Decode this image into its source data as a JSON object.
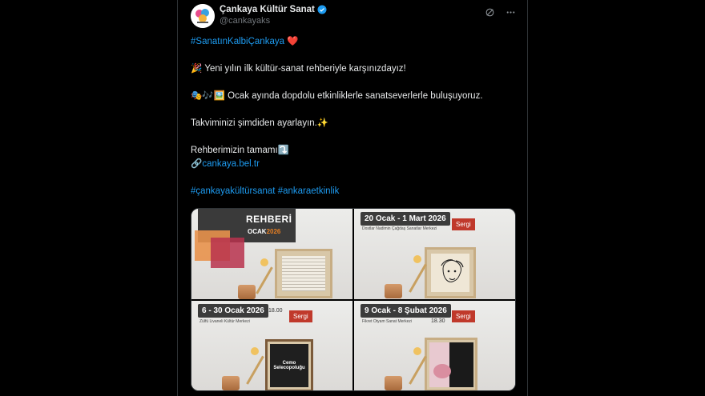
{
  "account": {
    "display_name": "Çankaya Kültür Sanat",
    "handle": "@cankayaks",
    "verified": true
  },
  "header_icons": [
    "grok-icon",
    "more-icon"
  ],
  "tweet": {
    "hashtag_line": "#SanatınKalbiÇankaya",
    "heart_emoji": "❤️",
    "line1_emoji": "🎉",
    "line1": "Yeni yılın ilk kültür-sanat rehberiyle karşınızdayız!",
    "line2_emoji": "🎭🎶🖼️",
    "line2": "Ocak ayında dopdolu etkinliklerle sanatseverlerle buluşuyoruz.",
    "line3": "Takviminizi şimdiden ayarlayın.",
    "line3_emoji": "✨",
    "line4": "Rehberimizin tamamı",
    "line4_emoji": "⤵️",
    "link_emoji": "🔗",
    "link": "cankaya.bel.tr",
    "hashtags": [
      "#çankayakültürsanat",
      "#ankaraetkinlik"
    ]
  },
  "media": {
    "cells": [
      {
        "title": "REHBERİ",
        "month_text": "OCAK",
        "month_year": "2026"
      },
      {
        "title": "20 Ocak - 1 Mart 2026",
        "sub": "Dostlar Nadimin Çağdaş Sanatlar Merkezi",
        "badge": "Sergi"
      },
      {
        "title": "6 - 30 Ocak 2026",
        "time": "18.00",
        "sub": "Zülfü Livaneli Kültür Merkezi",
        "badge": "Sergi"
      },
      {
        "title": "9 Ocak - 8 Şubat 2026",
        "time": "18.30",
        "sub": "Fikret Otyam Sanat Merkezi",
        "badge": "Sergi"
      }
    ],
    "poster_text": "Cemo Selecopoluğu"
  },
  "colors": {
    "link": "#1d9bf0",
    "badge": "#c0392b",
    "background": "#000000"
  }
}
